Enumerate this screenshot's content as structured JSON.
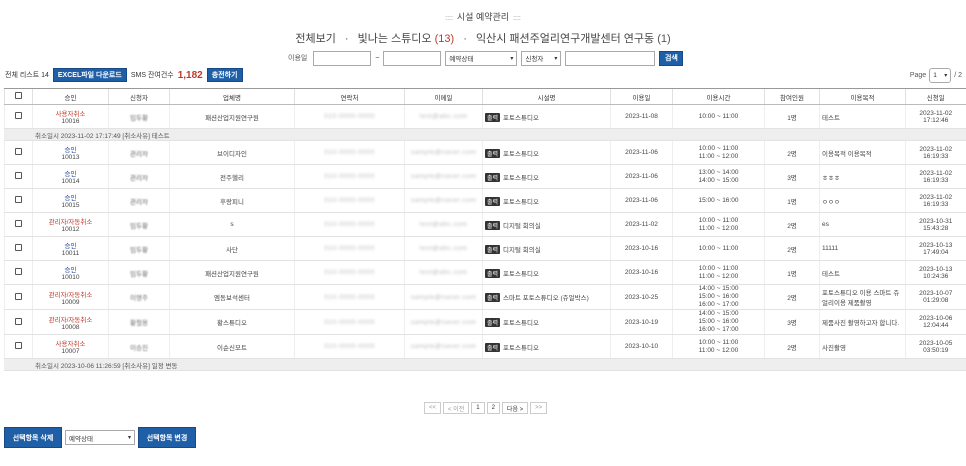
{
  "header": {
    "title": "시설 예약관리"
  },
  "subnav": {
    "all": "전체보기",
    "facility1": "빛나는 스튜디오",
    "facility1_count": "(13)",
    "facility2": "익산시 패션주얼리연구개발센터 연구동",
    "facility2_count": "(1)"
  },
  "search": {
    "date_label": "이용일",
    "tilde": "~",
    "status_select": "예약상태",
    "applicant_select": "신청자",
    "search_button": "검색"
  },
  "toolbar": {
    "total_label": "전체 리스트 14",
    "excel_button": "EXCEL파일 다운로드",
    "sms_label": "SMS 잔여건수",
    "sms_count": "1,182",
    "charge_button": "충전하기"
  },
  "page": {
    "label": "Page",
    "current": "1",
    "total": "/ 2"
  },
  "columns": [
    "승인",
    "신청자",
    "업체명",
    "연락처",
    "이메일",
    "시설명",
    "이용일",
    "이용시간",
    "참여인원",
    "이용목적",
    "신청일"
  ],
  "rows": [
    {
      "status": "사용자취소",
      "no": "10016",
      "applicant": "임두황",
      "company": "패션산업지원연구원",
      "phone": "010-0000-0000",
      "email": "test@abc.com",
      "facility": "포토스튜디오",
      "date": "2023-11-08",
      "time": [
        "10:00 ~ 11:00"
      ],
      "people": "1명",
      "purpose": "테스트",
      "applied": "2023-11-02 17:12:46",
      "note": "취소일시 2023-11-02 17:17:49   [취소사유] 테스트"
    },
    {
      "status": "승인",
      "no": "10013",
      "applicant": "관리자",
      "company": "브이디자인",
      "phone": "010-0000-0000",
      "email": "sample@naver.com",
      "facility": "포토스튜디오",
      "date": "2023-11-06",
      "time": [
        "10:00 ~ 11:00",
        "11:00 ~ 12:00"
      ],
      "people": "2명",
      "purpose": "이용목적 이용목적",
      "applied": "2023-11-02 16:19:33"
    },
    {
      "status": "승인",
      "no": "10014",
      "applicant": "관리자",
      "company": "전주헬리",
      "phone": "010-0000-0000",
      "email": "sample@naver.com",
      "facility": "포토스튜디오",
      "date": "2023-11-06",
      "time": [
        "13:00 ~ 14:00",
        "14:00 ~ 15:00"
      ],
      "people": "3명",
      "purpose": "ㅎㅎㅎ",
      "applied": "2023-11-02 16:19:33"
    },
    {
      "status": "승인",
      "no": "10015",
      "applicant": "관리자",
      "company": "후랑피니",
      "phone": "010-0000-0000",
      "email": "sample@naver.com",
      "facility": "포토스튜디오",
      "date": "2023-11-06",
      "time": [
        "15:00 ~ 16:00"
      ],
      "people": "1명",
      "purpose": "ㅇㅇㅇ",
      "applied": "2023-11-02 16:19:33"
    },
    {
      "status": "관리자/자동취소",
      "no": "10012",
      "applicant": "임두황",
      "company": "s",
      "phone": "010-0000-0000",
      "email": "test@abc.com",
      "facility": "디지털 회의실",
      "date": "2023-11-02",
      "time": [
        "10:00 ~ 11:00",
        "11:00 ~ 12:00"
      ],
      "people": "2명",
      "purpose": "es",
      "applied": "2023-10-31 15:43:28"
    },
    {
      "status": "승인",
      "no": "10011",
      "applicant": "임두황",
      "company": "사단",
      "phone": "010-0000-0000",
      "email": "test@abc.com",
      "facility": "디지털 회의실",
      "date": "2023-10-16",
      "time": [
        "10:00 ~ 11:00"
      ],
      "people": "2명",
      "purpose": "11111",
      "applied": "2023-10-13 17:49:04"
    },
    {
      "status": "승인",
      "no": "10010",
      "applicant": "임두황",
      "company": "패션산업지원연구원",
      "phone": "010-0000-0000",
      "email": "test@abc.com",
      "facility": "포토스튜디오",
      "date": "2023-10-16",
      "time": [
        "10:00 ~ 11:00",
        "11:00 ~ 12:00"
      ],
      "people": "1명",
      "purpose": "테스트",
      "applied": "2023-10-13 10:24:36"
    },
    {
      "status": "관리자/자동취소",
      "no": "10009",
      "applicant": "이영주",
      "company": "엠동보석센터",
      "phone": "010-0000-0000",
      "email": "sample@naver.com",
      "facility": "스마트 포토스튜디오 (쥬얼박스)",
      "date": "2023-10-25",
      "time": [
        "14:00 ~ 15:00",
        "15:00 ~ 16:00",
        "16:00 ~ 17:00"
      ],
      "people": "2명",
      "purpose": "포토스튜디오 이용 스마트 쥬얼리이용 제품촬영",
      "applied": "2023-10-07 01:29:08"
    },
    {
      "status": "관리자/자동취소",
      "no": "10008",
      "applicant": "황철용",
      "company": "황스튜디오",
      "phone": "010-0000-0000",
      "email": "sample@naver.com",
      "facility": "포토스튜디오",
      "date": "2023-10-19",
      "time": [
        "14:00 ~ 15:00",
        "15:00 ~ 16:00",
        "16:00 ~ 17:00"
      ],
      "people": "3명",
      "purpose": "제품사진 촬영하고자 합니다.",
      "applied": "2023-10-06 12:04:44"
    },
    {
      "status": "사용자취소",
      "no": "10007",
      "applicant": "이승진",
      "company": "이순신모트",
      "phone": "010-0000-0000",
      "email": "sample@naver.com",
      "facility": "포토스튜디오",
      "date": "2023-10-10",
      "time": [
        "10:00 ~ 11:00",
        "11:00 ~ 12:00"
      ],
      "people": "2명",
      "purpose": "사진촬영",
      "applied": "2023-10-05 03:50:19",
      "note": "취소일시 2023-10-06 11:26:59   [취소사유] 일정 변동"
    }
  ],
  "facility_tag": "출력",
  "pager": {
    "first": "<<",
    "prev": "< 이전",
    "pages": [
      "1",
      "2"
    ],
    "next": "다음 >",
    "last": ">>"
  },
  "bottom": {
    "delete_button": "선택항목 삭제",
    "status_select": "예약상태",
    "change_button": "선택항목 변경"
  },
  "colors": {
    "accent": "#1f5fa8",
    "cancel": "#c0392b",
    "approve": "#1f3f9e"
  }
}
